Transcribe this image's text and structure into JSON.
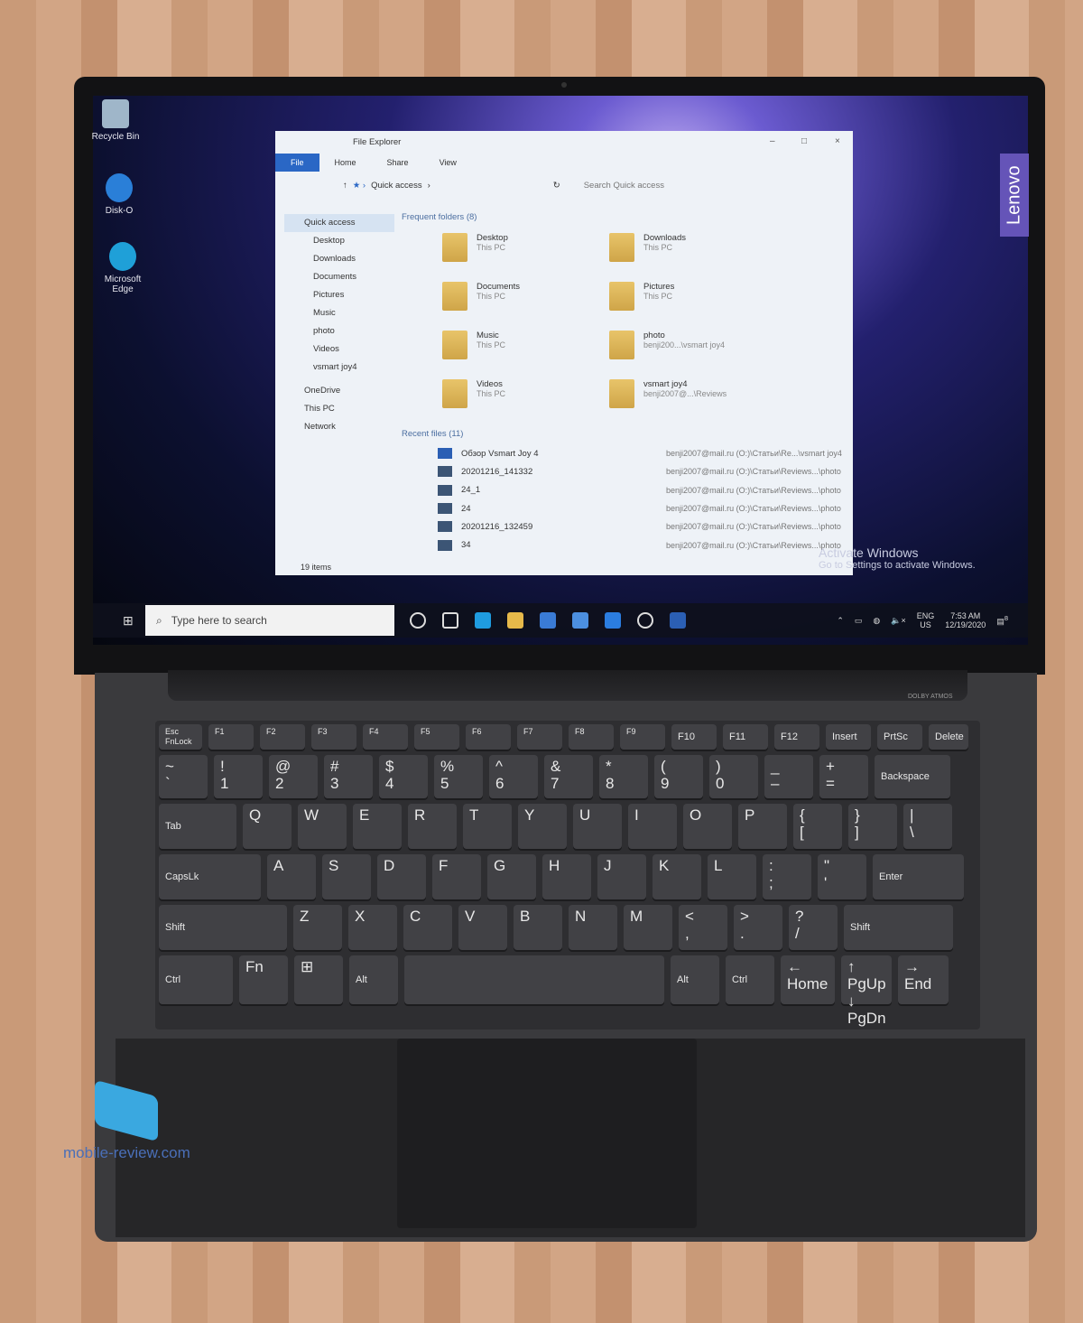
{
  "desktop": {
    "icons": [
      {
        "label": "Recycle Bin",
        "icon": "recycle-bin-icon"
      },
      {
        "label": "Disk-O",
        "icon": "disk-o-icon"
      },
      {
        "label": "Microsoft Edge",
        "icon": "edge-icon"
      }
    ],
    "brand": "Lenovo"
  },
  "explorer": {
    "title": "File Explorer",
    "window_controls": [
      "–",
      "□",
      "×"
    ],
    "ribbon_tabs": [
      "File",
      "Home",
      "Share",
      "View"
    ],
    "address": "Quick access",
    "search_placeholder": "Search Quick access",
    "nav": [
      "Quick access",
      "Desktop",
      "Downloads",
      "Documents",
      "Pictures",
      "Music",
      "photo",
      "Videos",
      "vsmart joy4",
      "OneDrive",
      "This PC",
      "Network"
    ],
    "frequent_header": "Frequent folders (8)",
    "folders": [
      {
        "name": "Desktop",
        "loc": "This PC"
      },
      {
        "name": "Downloads",
        "loc": "This PC"
      },
      {
        "name": "Documents",
        "loc": "This PC"
      },
      {
        "name": "Pictures",
        "loc": "This PC"
      },
      {
        "name": "Music",
        "loc": "This PC"
      },
      {
        "name": "photo",
        "loc": "benji200...\\vsmart joy4"
      },
      {
        "name": "Videos",
        "loc": "This PC"
      },
      {
        "name": "vsmart joy4",
        "loc": "benji2007@...\\Reviews"
      }
    ],
    "recent_header": "Recent files (11)",
    "recent": [
      {
        "name": "Обзор Vsmart Joy 4",
        "path": "benji2007@mail.ru (O:)\\Статьи\\Re...\\vsmart joy4"
      },
      {
        "name": "20201216_141332",
        "path": "benji2007@mail.ru (O:)\\Статьи\\Reviews...\\photo"
      },
      {
        "name": "24_1",
        "path": "benji2007@mail.ru (O:)\\Статьи\\Reviews...\\photo"
      },
      {
        "name": "24",
        "path": "benji2007@mail.ru (O:)\\Статьи\\Reviews...\\photo"
      },
      {
        "name": "20201216_132459",
        "path": "benji2007@mail.ru (O:)\\Статьи\\Reviews...\\photo"
      },
      {
        "name": "34",
        "path": "benji2007@mail.ru (O:)\\Статьи\\Reviews...\\photo"
      }
    ],
    "status": "19 items"
  },
  "activate": {
    "title": "Activate Windows",
    "subtitle": "Go to Settings to activate Windows."
  },
  "taskbar": {
    "search_placeholder": "Type here to search",
    "lang": "ENG",
    "region": "US",
    "time": "7:53 AM",
    "date": "12/19/2020",
    "notifications": "8",
    "apps": [
      "cortana-icon",
      "task-view-icon",
      "edge-icon",
      "file-explorer-icon",
      "store-icon",
      "mail-icon",
      "l-app-icon",
      "cortana-ring-icon",
      "word-icon"
    ],
    "colors": {
      "edge": "#1f9ce0",
      "explorer": "#e6b94a",
      "store": "#3a7bd5",
      "mail": "#4c8fe0",
      "word": "#2b5fb4"
    }
  },
  "laptop": {
    "speaker_label": "DOLBY ATMOS",
    "watermark": "mobile-review.com"
  },
  "keyboard": [
    [
      "Esc\nFnLock",
      "F1",
      "F2",
      "F3",
      "F4",
      "F5",
      "F6",
      "F7",
      "F8",
      "F9",
      "F10",
      "F11",
      "F12",
      "Insert",
      "PrtSc",
      "Delete"
    ],
    [
      "~\n`",
      "!\n1",
      "@\n2",
      "#\n3",
      "$\n4",
      "%\n5",
      "^\n6",
      "&\n7",
      "*\n8",
      "(\n9",
      ")\n0",
      "_\n–",
      "+\n=",
      "Backspace"
    ],
    [
      "Tab",
      "Q",
      "W",
      "E",
      "R",
      "T",
      "Y",
      "U",
      "I",
      "O",
      "P",
      "{\n[",
      "}\n]",
      "|\n\\"
    ],
    [
      "CapsLk",
      "A",
      "S",
      "D",
      "F",
      "G",
      "H",
      "J",
      "K",
      "L",
      ":\n;",
      "\"\n'",
      "Enter"
    ],
    [
      "Shift",
      "Z",
      "X",
      "C",
      "V",
      "B",
      "N",
      "M",
      "<\n,",
      ">\n.",
      "?\n/",
      "Shift"
    ],
    [
      "Ctrl",
      "Fn",
      "⊞",
      "Alt",
      "",
      "Alt",
      "Ctrl",
      "←\nHome",
      "↑ PgUp\n↓ PgDn",
      "→\nEnd"
    ]
  ]
}
